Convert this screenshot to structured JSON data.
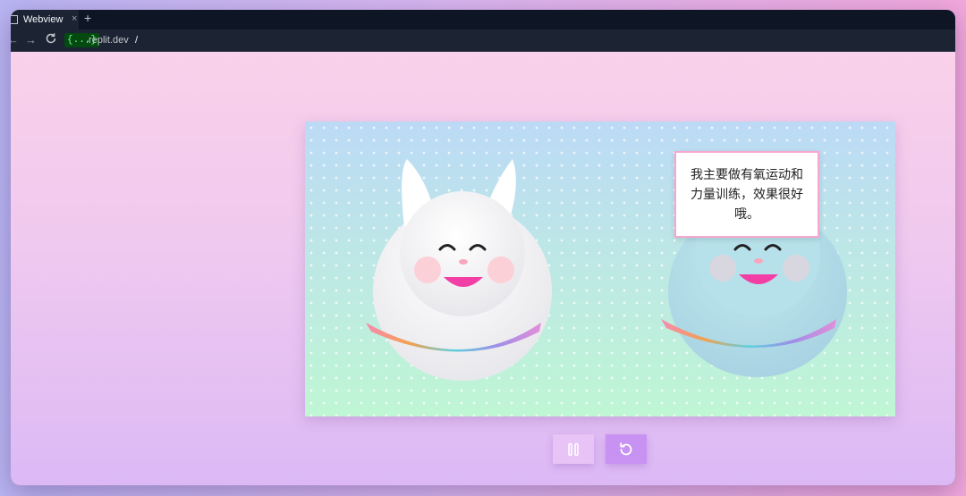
{
  "browser": {
    "tab_title": "Webview",
    "tab_close": "×",
    "new_tab": "+",
    "back_icon": "←",
    "forward_icon": "→",
    "url_chip": "{...}",
    "url_host": ".replit.dev",
    "url_path": "/"
  },
  "scene": {
    "speech_text": "我主要做有氧运动和力量训练，效果很好哦。"
  },
  "controls": {
    "pause_icon": "pause-icon",
    "reset_icon": "restart-icon"
  },
  "colors": {
    "pause_button": "#e7c3f6",
    "reset_button": "#c792f1",
    "bubble_border": "#f6a6cf"
  }
}
